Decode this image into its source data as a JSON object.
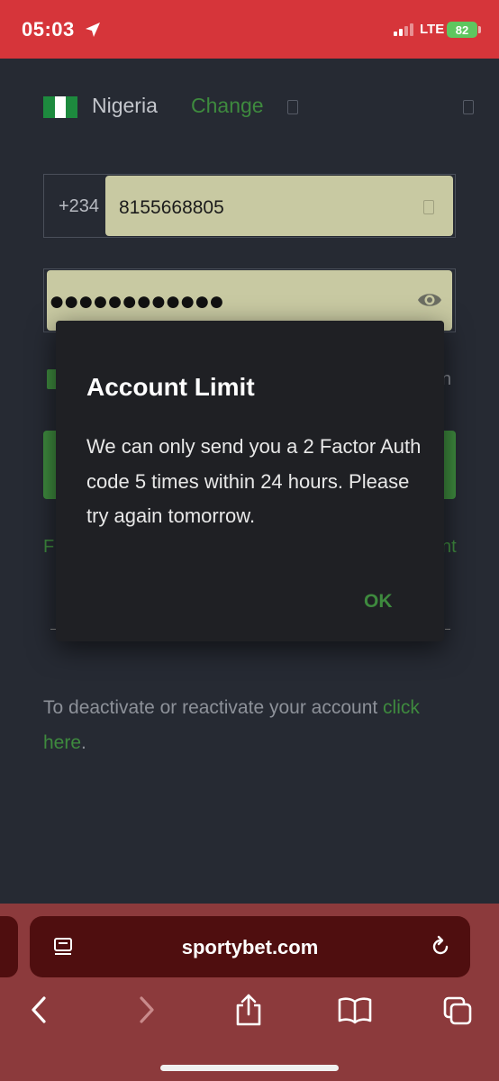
{
  "status_bar": {
    "time": "05:03",
    "network": "LTE",
    "battery": "82",
    "icons": [
      "location-arrow-icon",
      "cellular-signal-icon",
      "battery-charging-icon"
    ]
  },
  "country": {
    "name": "Nigeria",
    "change_label": "Change",
    "flag_colors": [
      "#1d8a3e",
      "#ffffff",
      "#1d8a3e"
    ]
  },
  "phone": {
    "prefix": "+234",
    "value": "8155668805"
  },
  "password": {
    "masked_value": "●●●●●●●●●●●●",
    "toggle_icon": "eye-icon"
  },
  "background_peek": {
    "right_text": "n",
    "left_link_char": "F",
    "right_link_chars": "nt"
  },
  "deactivate": {
    "text": "To deactivate or reactivate your account ",
    "link_text": "click here",
    "suffix": "."
  },
  "modal": {
    "title": "Account Limit",
    "message": "We can only send you a 2 Factor Auth code 5 times within 24 hours. Please try again tomorrow.",
    "ok_label": "OK"
  },
  "browser": {
    "url": "sportybet.com",
    "icons": [
      "reader-mode-icon",
      "reload-icon",
      "back-icon",
      "forward-icon",
      "share-icon",
      "bookmarks-icon",
      "tabs-icon"
    ]
  },
  "colors": {
    "status_bar": "#d6353a",
    "page_bg": "#262a33",
    "accent_green": "#3e8a3e",
    "input_fill": "#c8c9a2",
    "modal_bg": "#1f2024",
    "browser_bar": "#8c3a3c"
  }
}
